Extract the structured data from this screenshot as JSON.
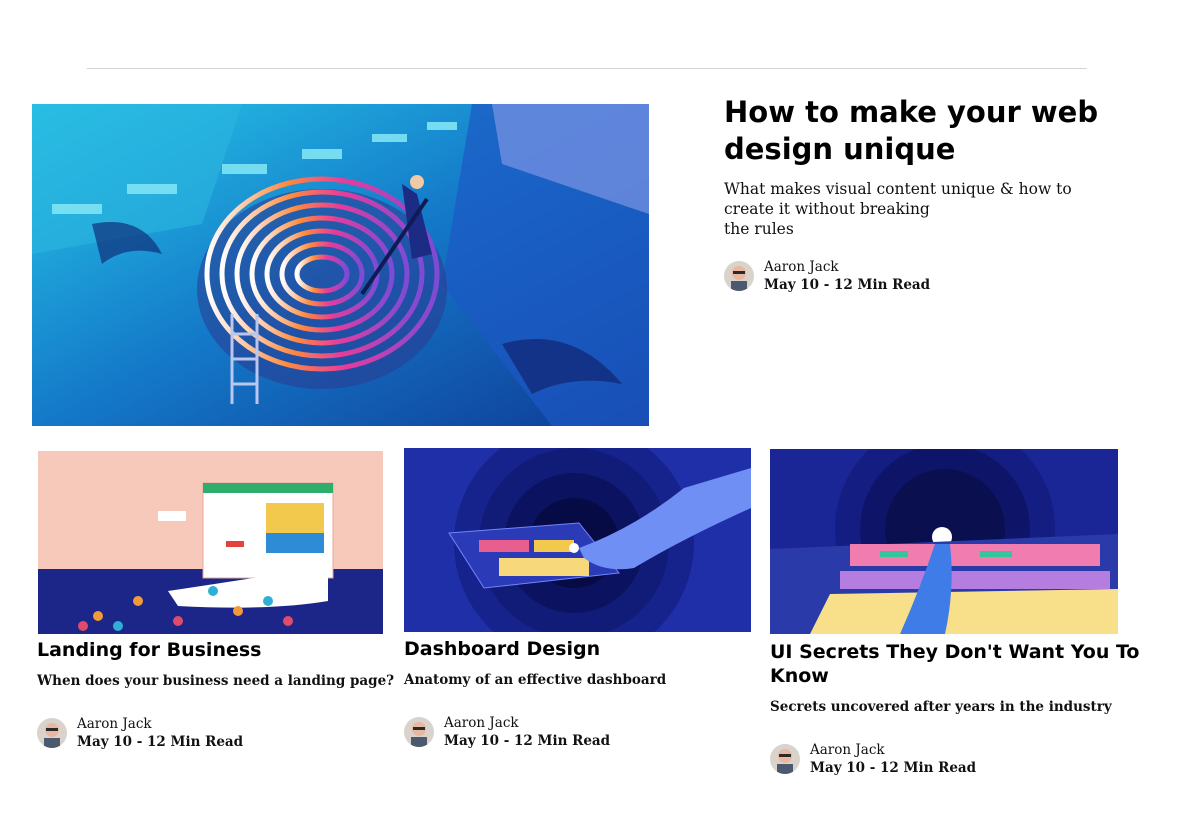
{
  "featured": {
    "title": "How to make your web design unique",
    "subtitle_lines": [
      "What makes visual content unique & how to create it without breaking",
      "the rules"
    ],
    "author": "Aaron Jack",
    "meta": "May 10 - 12 Min Read",
    "image": "fingerprint-pool-illustration"
  },
  "cards": [
    {
      "title": "Landing for Business",
      "subtitle": "When does your business need a landing page?",
      "author": "Aaron Jack",
      "meta": "May 10 - 12 Min Read",
      "image": "landing-page-crowd-illustration"
    },
    {
      "title": "Dashboard Design",
      "subtitle": "Anatomy of an effective dashboard",
      "author": "Aaron Jack",
      "meta": "May 10 - 12 Min Read",
      "image": "hand-touching-dashboard-illustration"
    },
    {
      "title": "UI Secrets They Don't Want You To Know",
      "subtitle": "Secrets uncovered after years in the industry",
      "author": "Aaron Jack",
      "meta": "May 10 - 12 Min Read",
      "image": "space-dashboard-illustration"
    }
  ],
  "colors": {
    "pool_blue": "#1a8fd6",
    "deep_blue": "#1f2fa8",
    "peach": "#f6c9bb",
    "navy": "#1c2588"
  }
}
